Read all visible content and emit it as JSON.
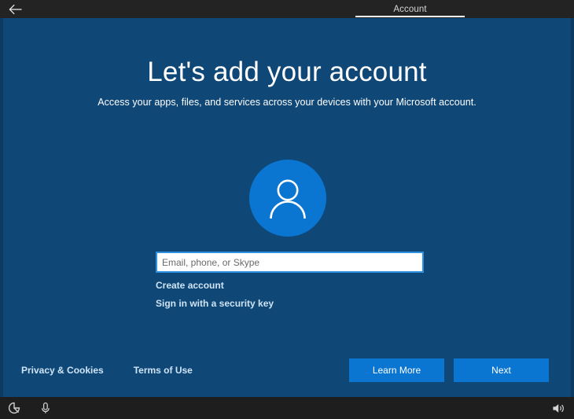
{
  "titlebar": {
    "back_icon": "back-arrow-icon",
    "tab_label": "Account"
  },
  "main": {
    "title": "Let's add your account",
    "subtitle": "Access your apps, files, and services across your devices with your Microsoft account.",
    "avatar_icon": "person-avatar-icon",
    "input_placeholder": "Email, phone, or Skype",
    "input_value": "",
    "links": [
      {
        "label": "Create account"
      },
      {
        "label": "Sign in with a security key"
      }
    ]
  },
  "footer": {
    "links": [
      {
        "label": "Privacy & Cookies"
      },
      {
        "label": "Terms of Use"
      }
    ],
    "buttons": [
      {
        "label": "Learn More"
      },
      {
        "label": "Next"
      }
    ]
  },
  "systembar": {
    "left_icons": [
      {
        "name": "ease-of-access-icon"
      },
      {
        "name": "narrator-microphone-icon"
      }
    ],
    "right_icons": [
      {
        "name": "volume-speaker-icon"
      }
    ]
  },
  "colors": {
    "page_background": "#0f4777",
    "accent_blue": "#0a76d1",
    "chrome_dark": "#232323",
    "link_blue": "#cfe4f5",
    "input_border_focus": "#2f8fe0"
  }
}
